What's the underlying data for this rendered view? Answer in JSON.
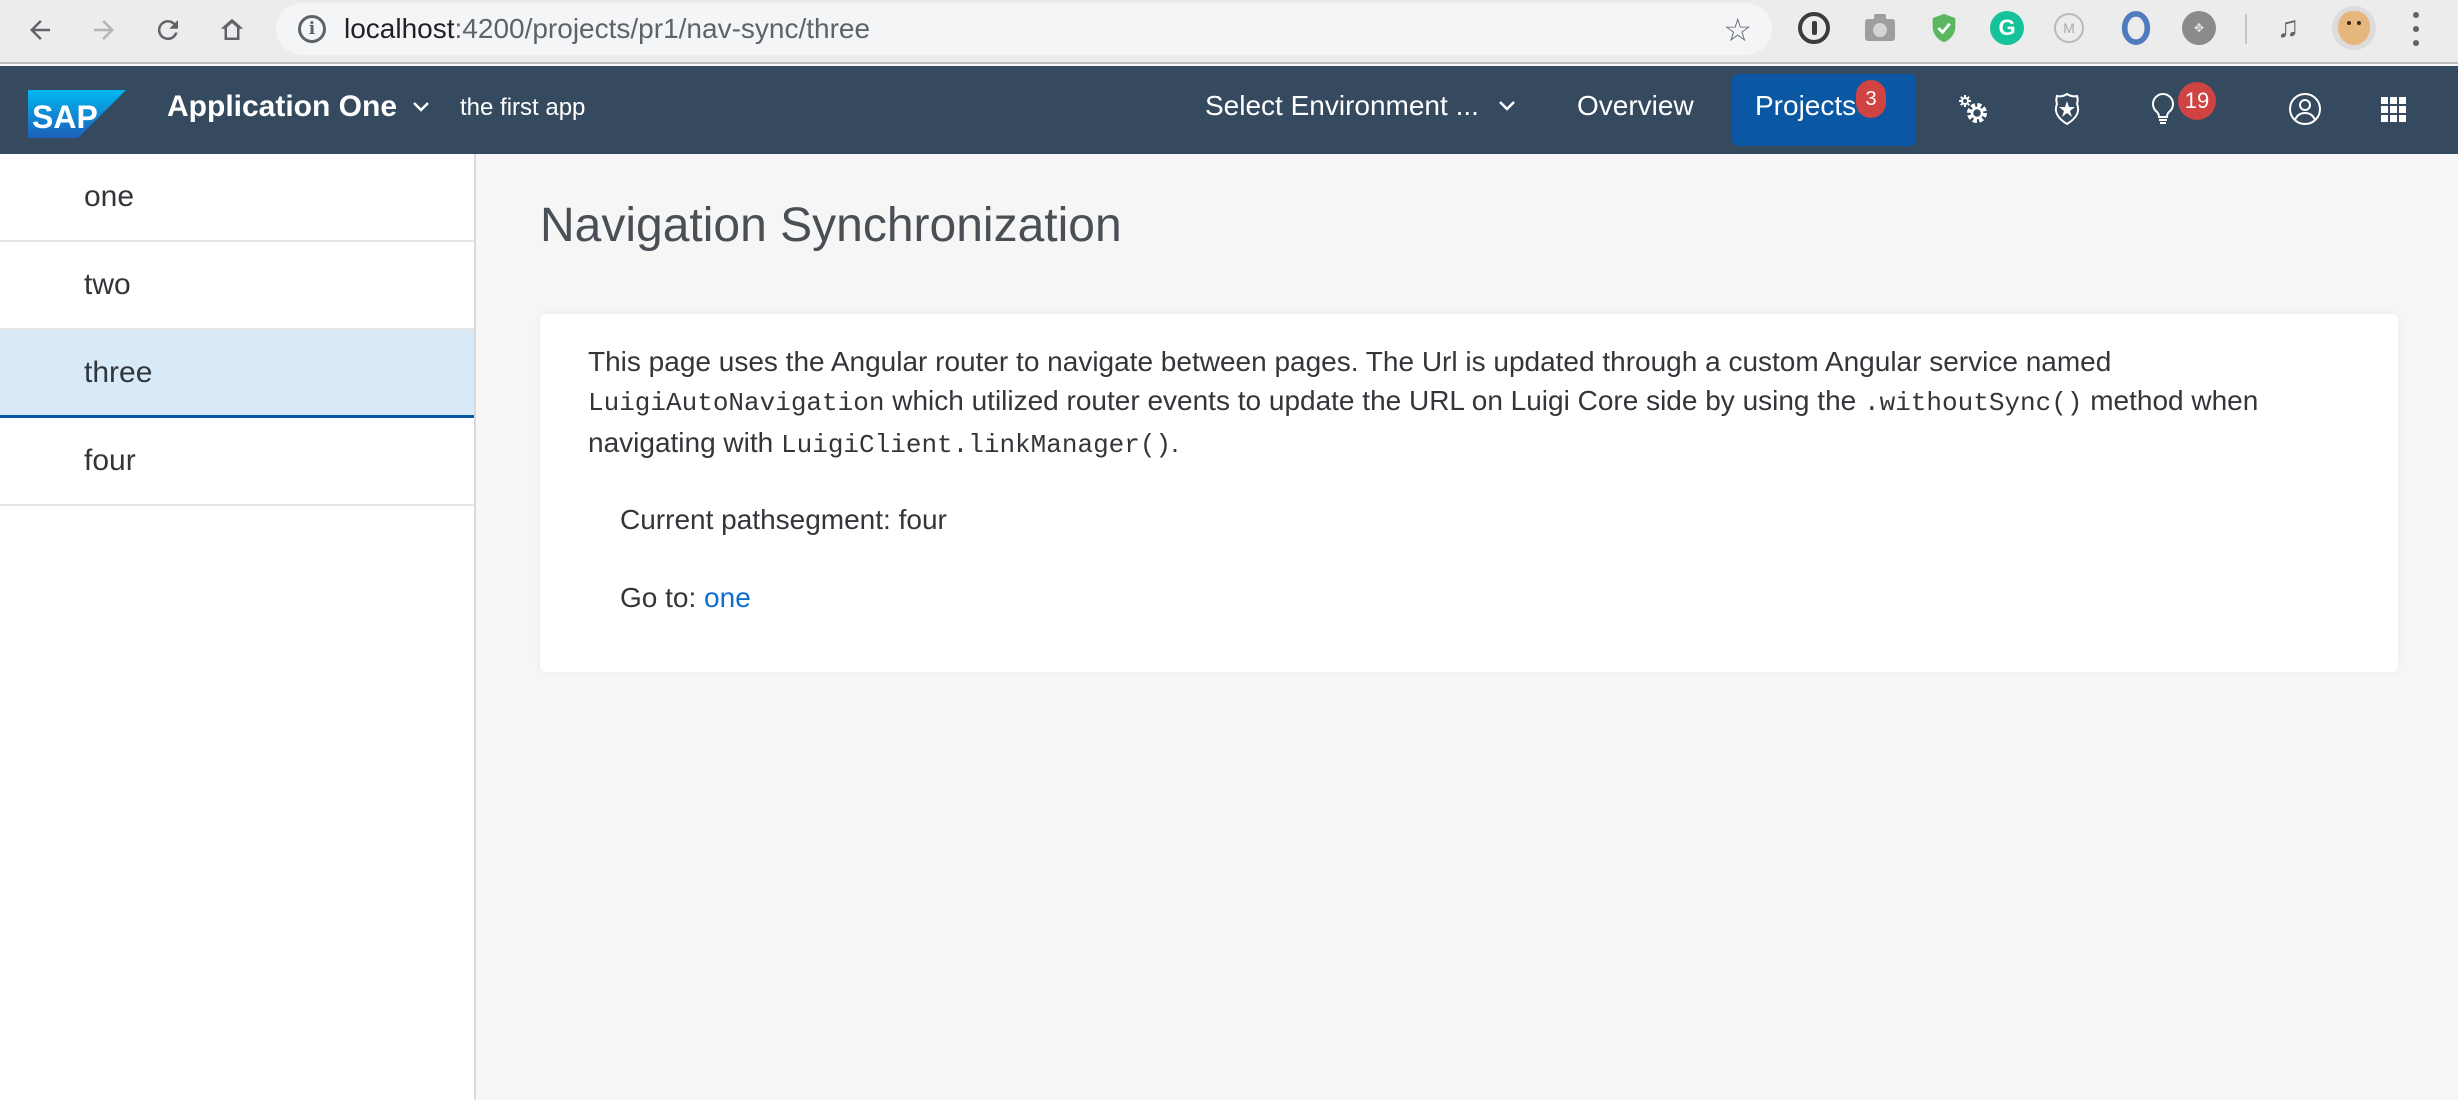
{
  "browser": {
    "url_host": "localhost",
    "url_rest": ":4200/projects/pr1/nav-sync/three",
    "icons": [
      "back-icon",
      "forward-icon",
      "reload-icon",
      "home-icon",
      "site-info-icon",
      "bookmark-star-icon",
      "1password-extension-icon",
      "camera-extension-icon",
      "adguard-extension-icon",
      "grammarly-extension-icon",
      "m-extension-icon",
      "jsonview-extension-icon",
      "grey-extension-icon",
      "media-control-icon",
      "profile-avatar",
      "menu-kebab-icon"
    ],
    "ext_g_label": "G",
    "ext_m_label": "M"
  },
  "shellbar": {
    "logo_text": "SAP",
    "app_title": "Application One",
    "app_subtitle": "the first app",
    "environment_select": "Select Environment ...",
    "overview_label": "Overview",
    "projects_label": "Projects",
    "projects_badge": "3",
    "notifications_badge": "19",
    "colors": {
      "background": "#354a5f",
      "active": "#0a57a4",
      "badge": "#d04343"
    }
  },
  "sidebar": {
    "items": [
      {
        "label": "one",
        "active": false
      },
      {
        "label": "two",
        "active": false
      },
      {
        "label": "three",
        "active": true
      },
      {
        "label": "four",
        "active": false
      }
    ]
  },
  "main": {
    "title": "Navigation Synchronization",
    "desc": {
      "p1": "This page uses the Angular router to navigate between pages. The Url is updated through a custom Angular service named ",
      "code1": "LuigiAutoNavigation",
      "p2": " which utilized router events to update the URL on Luigi Core side by using the ",
      "code2": ".withoutSync()",
      "p3": " method when navigating with ",
      "code3": "LuigiClient.linkManager()",
      "p4": "."
    },
    "path_label": "Current pathsegment: four",
    "goto_label": "Go to: ",
    "goto_link": "one"
  }
}
